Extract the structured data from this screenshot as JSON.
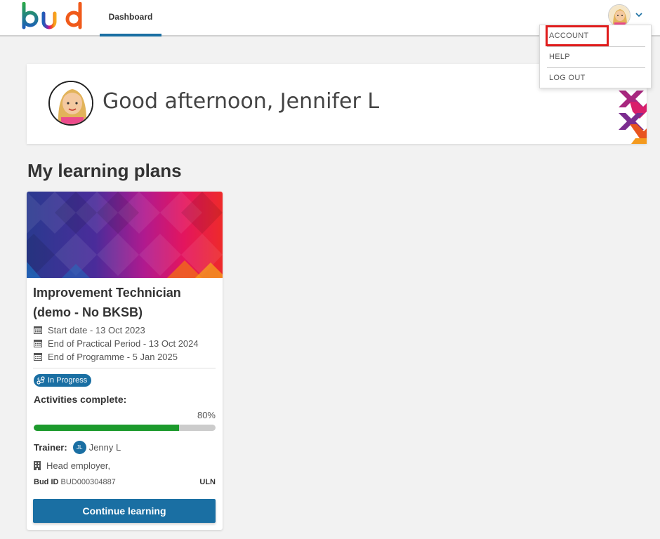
{
  "header": {
    "logo_text": "bud",
    "nav_tab": "Dashboard"
  },
  "user_menu": {
    "items": [
      {
        "label": "ACCOUNT"
      },
      {
        "label": "HELP"
      },
      {
        "label": "LOG OUT"
      }
    ]
  },
  "greeting": {
    "text": "Good afternoon, Jennifer L"
  },
  "section": {
    "title": "My learning plans"
  },
  "plan": {
    "title": "Improvement Technician (demo - No BKSB)",
    "start_date": "Start date - 13 Oct 2023",
    "end_practical": "End of Practical Period - 13 Oct 2024",
    "end_programme": "End of Programme - 5 Jan 2025",
    "status": "In Progress",
    "activities_label": "Activities complete:",
    "activities_percent": "80%",
    "progress_fraction": 0.8,
    "trainer_label": "Trainer:",
    "trainer_initials": "JL",
    "trainer_name": "Jenny L",
    "employer": "Head employer,",
    "bud_id_label": "Bud ID",
    "bud_id_value": "BUD000304887",
    "uln_label": "ULN",
    "continue_label": "Continue learning"
  },
  "colors": {
    "accent": "#1a6fa3",
    "progress_fill": "#1c9a2c",
    "highlight_box": "#e01b1b"
  }
}
